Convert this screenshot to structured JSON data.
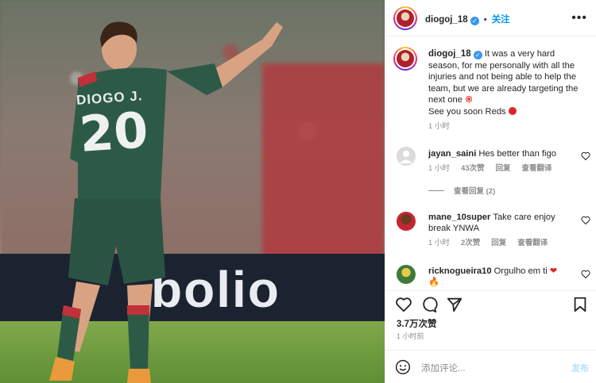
{
  "photo": {
    "jersey_name": "DIOGO J.",
    "jersey_number": "20"
  },
  "header": {
    "username": "diogoj_18",
    "follow_label": "关注",
    "more_label": "•••"
  },
  "caption": {
    "username": "diogoj_18",
    "text": "It was a very hard season, for me personally with all the injuries and not being able to help the team, but we are already targeting the next one",
    "text2": "See you soon Reds",
    "time": "1 小时"
  },
  "comments": [
    {
      "username": "jayan_saini",
      "text": "Hes better than figo",
      "time": "1 小时",
      "likes": "43次赞",
      "reply": "回复",
      "translate": "查看翻译"
    },
    {
      "username": "mane_10super",
      "text": "Take care enjoy break YNWA",
      "time": "1 小时",
      "likes": "2次赞",
      "reply": "回复",
      "translate": "查看翻译"
    },
    {
      "username": "ricknogueira10",
      "text": "Orgulho em ti"
    }
  ],
  "view_replies": "查看回复 (2)",
  "actions": {
    "likes": "3.7万次赞",
    "time_ago": "1 小时前"
  },
  "add_comment": {
    "placeholder": "添加评论...",
    "post_label": "发布"
  },
  "colors": {
    "accent": "#0095f6",
    "verified": "#3897f0",
    "jersey": "#2d5a47"
  }
}
